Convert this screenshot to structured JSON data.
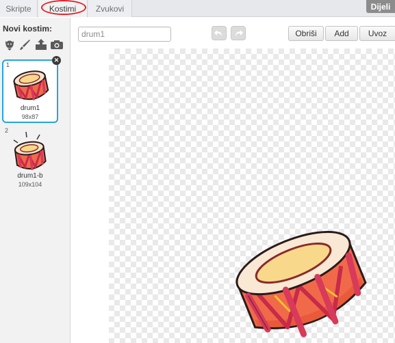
{
  "tabs": {
    "scripts": "Skripte",
    "costumes": "Kostimi",
    "sounds": "Zvukovi",
    "active": "Kostimi"
  },
  "share_label": "Dijeli",
  "sidebar": {
    "new_costume_label": "Novi kostim:",
    "new_costume_icons": [
      "character-library-icon",
      "paint-brush-icon",
      "upload-icon",
      "camera-icon"
    ],
    "costumes": [
      {
        "number": "1",
        "name": "drum1",
        "size": "98x87",
        "selected": true
      },
      {
        "number": "2",
        "name": "drum1-b",
        "size": "109x104",
        "selected": false
      }
    ]
  },
  "editor": {
    "costume_name_value": "drum1",
    "buttons": {
      "clear": "Obriši",
      "add": "Add",
      "import": "Uvoz"
    }
  },
  "colors": {
    "selection_border": "#25a4dc",
    "highlight_ellipse": "#e0202a",
    "drum_body": "#f06a4a",
    "drum_strap": "#d83a5a",
    "drum_top": "#f8d88a"
  }
}
